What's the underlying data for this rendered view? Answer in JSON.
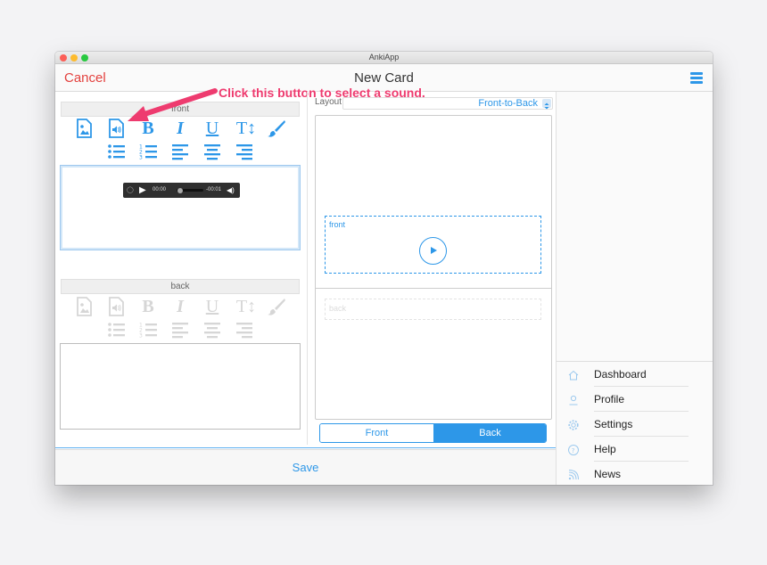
{
  "window": {
    "title": "AnkiApp"
  },
  "navbar": {
    "cancel_label": "Cancel",
    "title": "New Card"
  },
  "annotation": {
    "text": "Click this button to select a sound."
  },
  "front_editor": {
    "label": "front",
    "toolbar": {
      "bold": "B",
      "italic": "I",
      "underline": "U",
      "text_size": "T↕"
    },
    "audio_player": {
      "current_time": "00:00",
      "remaining_time": "-00:01",
      "progress_percent": 2
    }
  },
  "back_editor": {
    "label": "back",
    "toolbar": {
      "bold": "B",
      "italic": "I",
      "underline": "U",
      "text_size": "T↕"
    }
  },
  "preview": {
    "layout_label": "Layout",
    "layout_value": "Front-to-Back",
    "front_label": "front",
    "back_label": "back",
    "segment": {
      "front": "Front",
      "back": "Back",
      "selected": "Back"
    }
  },
  "savebar": {
    "save_label": "Save"
  },
  "sidebar": {
    "items": [
      {
        "label": "Dashboard",
        "icon": "home-icon"
      },
      {
        "label": "Profile",
        "icon": "user-icon"
      },
      {
        "label": "Settings",
        "icon": "gear-icon"
      },
      {
        "label": "Help",
        "icon": "help-icon"
      },
      {
        "label": "News",
        "icon": "rss-icon"
      }
    ]
  },
  "colors": {
    "accent": "#2d97e8",
    "cancel": "#e3413e",
    "annotation": "#ee3b6f"
  }
}
